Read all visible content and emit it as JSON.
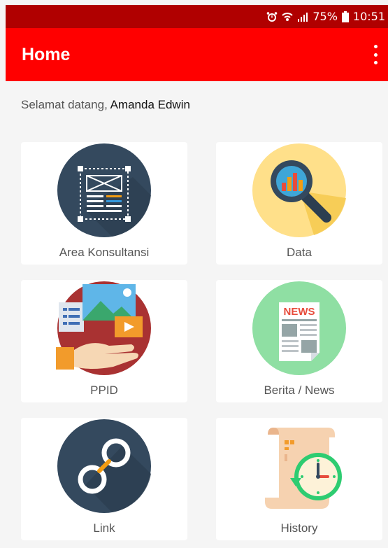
{
  "status_bar": {
    "battery": "75%",
    "time": "10:51",
    "icons": [
      "alarm-icon",
      "wifi-calling-icon",
      "signal-icon",
      "battery-icon"
    ]
  },
  "app_bar": {
    "title": "Home",
    "menu_icon": "more-vert-icon"
  },
  "greeting": {
    "prefix": "Selamat datang, ",
    "user_name": "Amanda Edwin"
  },
  "menu_items": [
    {
      "label": "Area Konsultansi",
      "icon": "blueprint-icon"
    },
    {
      "label": "Data",
      "icon": "magnifier-chart-icon"
    },
    {
      "label": "PPID",
      "icon": "media-hand-icon"
    },
    {
      "label": "Berita / News",
      "icon": "newspaper-icon"
    },
    {
      "label": "Link",
      "icon": "link-icon"
    },
    {
      "label": "History",
      "icon": "history-clock-icon"
    }
  ],
  "colors": {
    "status_bar": "#b00000",
    "app_bar": "#ff0000",
    "background": "#f5f5f5"
  }
}
